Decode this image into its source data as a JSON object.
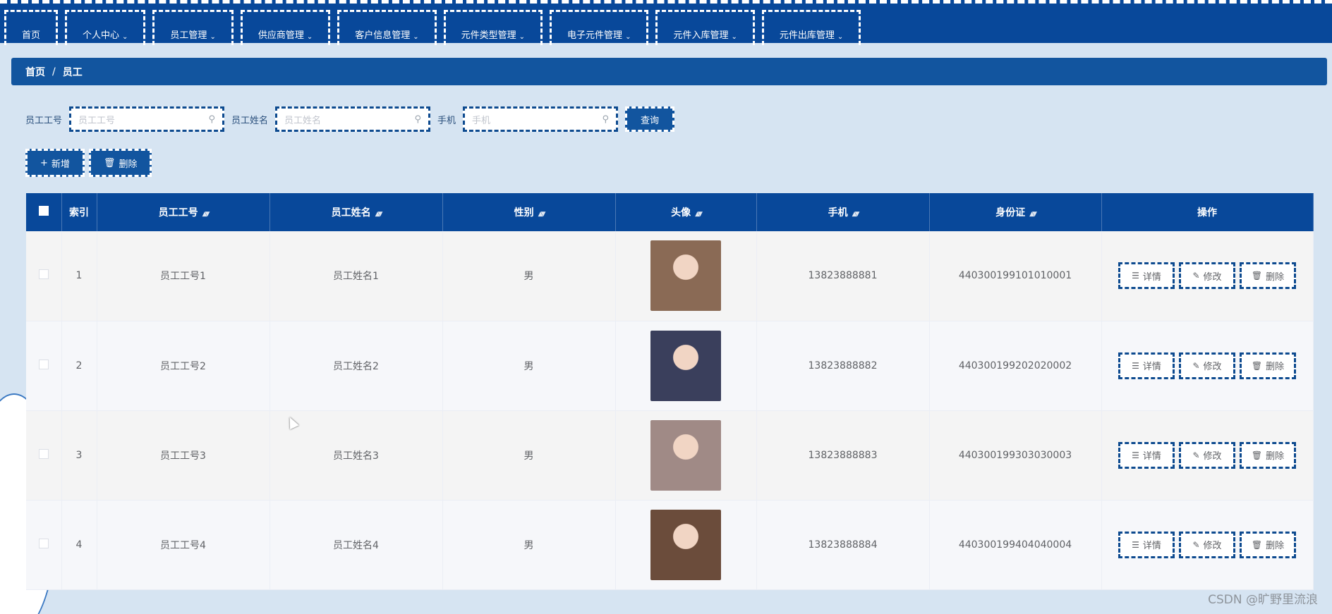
{
  "nav": {
    "items": [
      {
        "label": "首页",
        "dropdown": false
      },
      {
        "label": "个人中心",
        "dropdown": true
      },
      {
        "label": "员工管理",
        "dropdown": true
      },
      {
        "label": "供应商管理",
        "dropdown": true
      },
      {
        "label": "客户信息管理",
        "dropdown": true
      },
      {
        "label": "元件类型管理",
        "dropdown": true
      },
      {
        "label": "电子元件管理",
        "dropdown": true
      },
      {
        "label": "元件入库管理",
        "dropdown": true
      },
      {
        "label": "元件出库管理",
        "dropdown": true
      }
    ]
  },
  "breadcrumb": {
    "home": "首页",
    "separator": "/",
    "current": "员工"
  },
  "search": {
    "fields": [
      {
        "label": "员工工号",
        "placeholder": "员工工号"
      },
      {
        "label": "员工姓名",
        "placeholder": "员工姓名"
      },
      {
        "label": "手机",
        "placeholder": "手机"
      }
    ],
    "button": "查询"
  },
  "actions": {
    "add": "新增",
    "delete": "删除"
  },
  "table": {
    "columns": [
      "索引",
      "员工工号",
      "员工姓名",
      "性别",
      "头像",
      "手机",
      "身份证",
      "操作"
    ],
    "sortable": [
      false,
      true,
      true,
      true,
      true,
      true,
      true,
      false
    ],
    "ops": {
      "detail": "详情",
      "edit": "修改",
      "delete": "删除"
    },
    "rows": [
      {
        "index": "1",
        "id": "员工工号1",
        "name": "员工姓名1",
        "gender": "男",
        "phone": "13823888881",
        "idcard": "440300199101010001",
        "avatar_color": "#8a6a55"
      },
      {
        "index": "2",
        "id": "员工工号2",
        "name": "员工姓名2",
        "gender": "男",
        "phone": "13823888882",
        "idcard": "440300199202020002",
        "avatar_color": "#3a3f5c"
      },
      {
        "index": "3",
        "id": "员工工号3",
        "name": "员工姓名3",
        "gender": "男",
        "phone": "13823888883",
        "idcard": "440300199303030003",
        "avatar_color": "#a08a86"
      },
      {
        "index": "4",
        "id": "员工工号4",
        "name": "员工姓名4",
        "gender": "男",
        "phone": "13823888884",
        "idcard": "440300199404040004",
        "avatar_color": "#6b4c3b"
      }
    ]
  },
  "colors": {
    "nav_bg": "#08489a",
    "accent": "#12559f",
    "page_bg": "#d6e4f2"
  },
  "watermark": "CSDN @旷野里流浪"
}
